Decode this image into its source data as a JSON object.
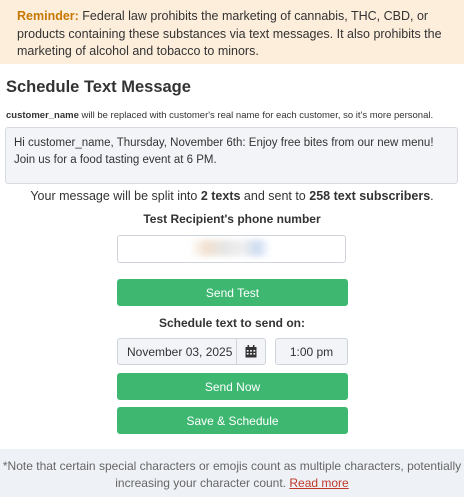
{
  "reminder": {
    "label": "Reminder:",
    "text": " Federal law prohibits the marketing of cannabis, THC, CBD, or products containing these substances via text messages. It also prohibits the marketing of alcohol and tobacco to minors."
  },
  "title": "Schedule Text Message",
  "hint": {
    "token": "customer_name",
    "text": " will be replaced with customer's real name for each customer, so it's more personal."
  },
  "message": {
    "value": "Hi customer_name, Thursday, November 6th:  Enjoy free bites from our new menu! Join us for a food tasting event at 6 PM."
  },
  "split_info": {
    "prefix": "Your message will be split into ",
    "texts": "2 texts",
    "middle": " and sent to ",
    "subscribers": "258 text subscribers",
    "suffix": "."
  },
  "test_recipient": {
    "label": "Test Recipient's phone number",
    "value": "",
    "send_test_label": "Send Test"
  },
  "schedule": {
    "label": "Schedule text to send on:",
    "date": "November 03, 2025",
    "calendar_icon": "calendar-icon",
    "time": "1:00 pm",
    "send_now_label": "Send Now",
    "save_schedule_label": "Save & Schedule"
  },
  "footer": {
    "note": "*Note that certain special characters or emojis count as multiple characters, potentially increasing your character count. ",
    "link": "Read more"
  },
  "colors": {
    "accent_green": "#3eb871",
    "reminder_bg": "#fdeedc",
    "reminder_label": "#c77800",
    "link_red": "#c0392b"
  }
}
